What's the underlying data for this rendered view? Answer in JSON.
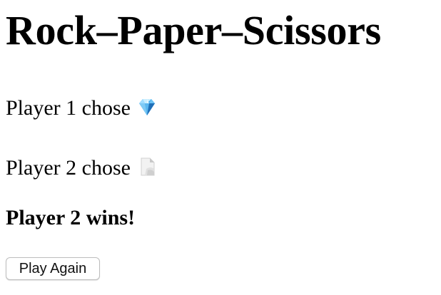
{
  "game": {
    "title": "Rock–Paper–Scissors",
    "player1": {
      "text": "Player 1 chose",
      "choice_icon": "gem-icon"
    },
    "player2": {
      "text": "Player 2 chose",
      "choice_icon": "page-icon"
    },
    "result": "Player 2 wins!",
    "play_again_label": "Play Again"
  },
  "colors": {
    "gem_light": "#9fdcff",
    "gem_mid": "#3ba5e8",
    "gem_dark": "#1f6fb8",
    "page_fill": "#f2f2f2",
    "page_fold": "#c8c8c8"
  }
}
